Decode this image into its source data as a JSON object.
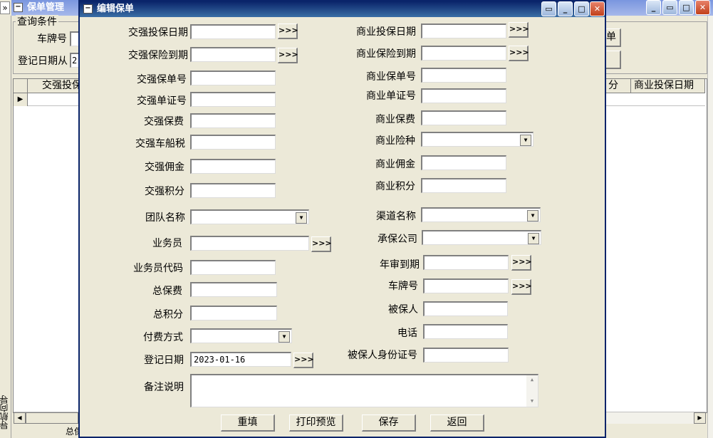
{
  "colors": {
    "title_active": "#0a246a",
    "title_inactive": "#7a96df",
    "face": "#ece9d8",
    "close": "#c1401b"
  },
  "background": {
    "window_title": "保单管理",
    "group_label": "查询条件",
    "plate_label": "车牌号",
    "reg_from_label": "登记日期从",
    "reg_from_value": "2",
    "right_btn1": "单",
    "grid_col1": "交强投保",
    "grid_col_right1": "分",
    "grid_col_right2": "商业投保日期",
    "side_label": "导航向导",
    "bottom_label": "总保",
    "chevron": "»"
  },
  "dialog": {
    "title": "编辑保单",
    "left": {
      "ci_start_label": "交强投保日期",
      "ci_end_label": "交强保险到期",
      "ci_policy_label": "交强保单号",
      "ci_cert_label": "交强单证号",
      "ci_premium_label": "交强保费",
      "ci_tax_label": "交强车船税",
      "ci_commission_label": "交强佣金",
      "ci_points_label": "交强积分",
      "team_label": "团队名称",
      "salesman_label": "业务员",
      "salesman_code_label": "业务员代码",
      "total_premium_label": "总保费",
      "total_points_label": "总积分",
      "payment_label": "付费方式",
      "reg_date_label": "登记日期",
      "reg_date_value": "2023-01-16",
      "remarks_label": "备注说明"
    },
    "right": {
      "bi_start_label": "商业投保日期",
      "bi_end_label": "商业保险到期",
      "bi_policy_label": "商业保单号",
      "bi_cert_label": "商业单证号",
      "bi_premium_label": "商业保费",
      "bi_type_label": "商业险种",
      "bi_commission_label": "商业佣金",
      "bi_points_label": "商业积分",
      "channel_label": "渠道名称",
      "insurer_label": "承保公司",
      "inspection_label": "年审到期",
      "plate_label": "车牌号",
      "insured_label": "被保人",
      "phone_label": "电话",
      "id_label": "被保人身份证号"
    },
    "buttons": {
      "reset": "重填",
      "print_preview": "打印预览",
      "save": "保存",
      "back": "返回"
    },
    "dots": ">>>"
  }
}
